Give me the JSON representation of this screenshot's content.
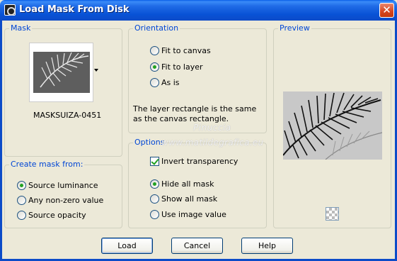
{
  "window": {
    "title": "Load Mask From Disk",
    "close_icon": "close-icon"
  },
  "mask": {
    "legend": "Mask",
    "name": "MASKSUIZA-0451"
  },
  "create_mask_from": {
    "legend": "Create mask from:",
    "options": [
      {
        "label": "Source luminance",
        "checked": true
      },
      {
        "label": "Any non-zero value",
        "checked": false
      },
      {
        "label": "Source opacity",
        "checked": false
      }
    ]
  },
  "orientation": {
    "legend": "Orientation",
    "options": [
      {
        "label": "Fit to canvas",
        "checked": false
      },
      {
        "label": "Fit to layer",
        "checked": true
      },
      {
        "label": "As is",
        "checked": false
      }
    ],
    "description": "The layer rectangle is the same as the canvas rectangle."
  },
  "options": {
    "legend": "Options",
    "invert_transparency": {
      "label": "Invert transparency",
      "checked": true
    },
    "mask_options": [
      {
        "label": "Hide all mask",
        "checked": true
      },
      {
        "label": "Show all mask",
        "checked": false
      },
      {
        "label": "Use image value",
        "checked": false
      }
    ]
  },
  "preview": {
    "legend": "Preview"
  },
  "watermark": {
    "line1": "Pinuccia",
    "line2": "www.matildegrafica.eu"
  },
  "buttons": {
    "load": "Load",
    "cancel": "Cancel",
    "help": "Help"
  }
}
